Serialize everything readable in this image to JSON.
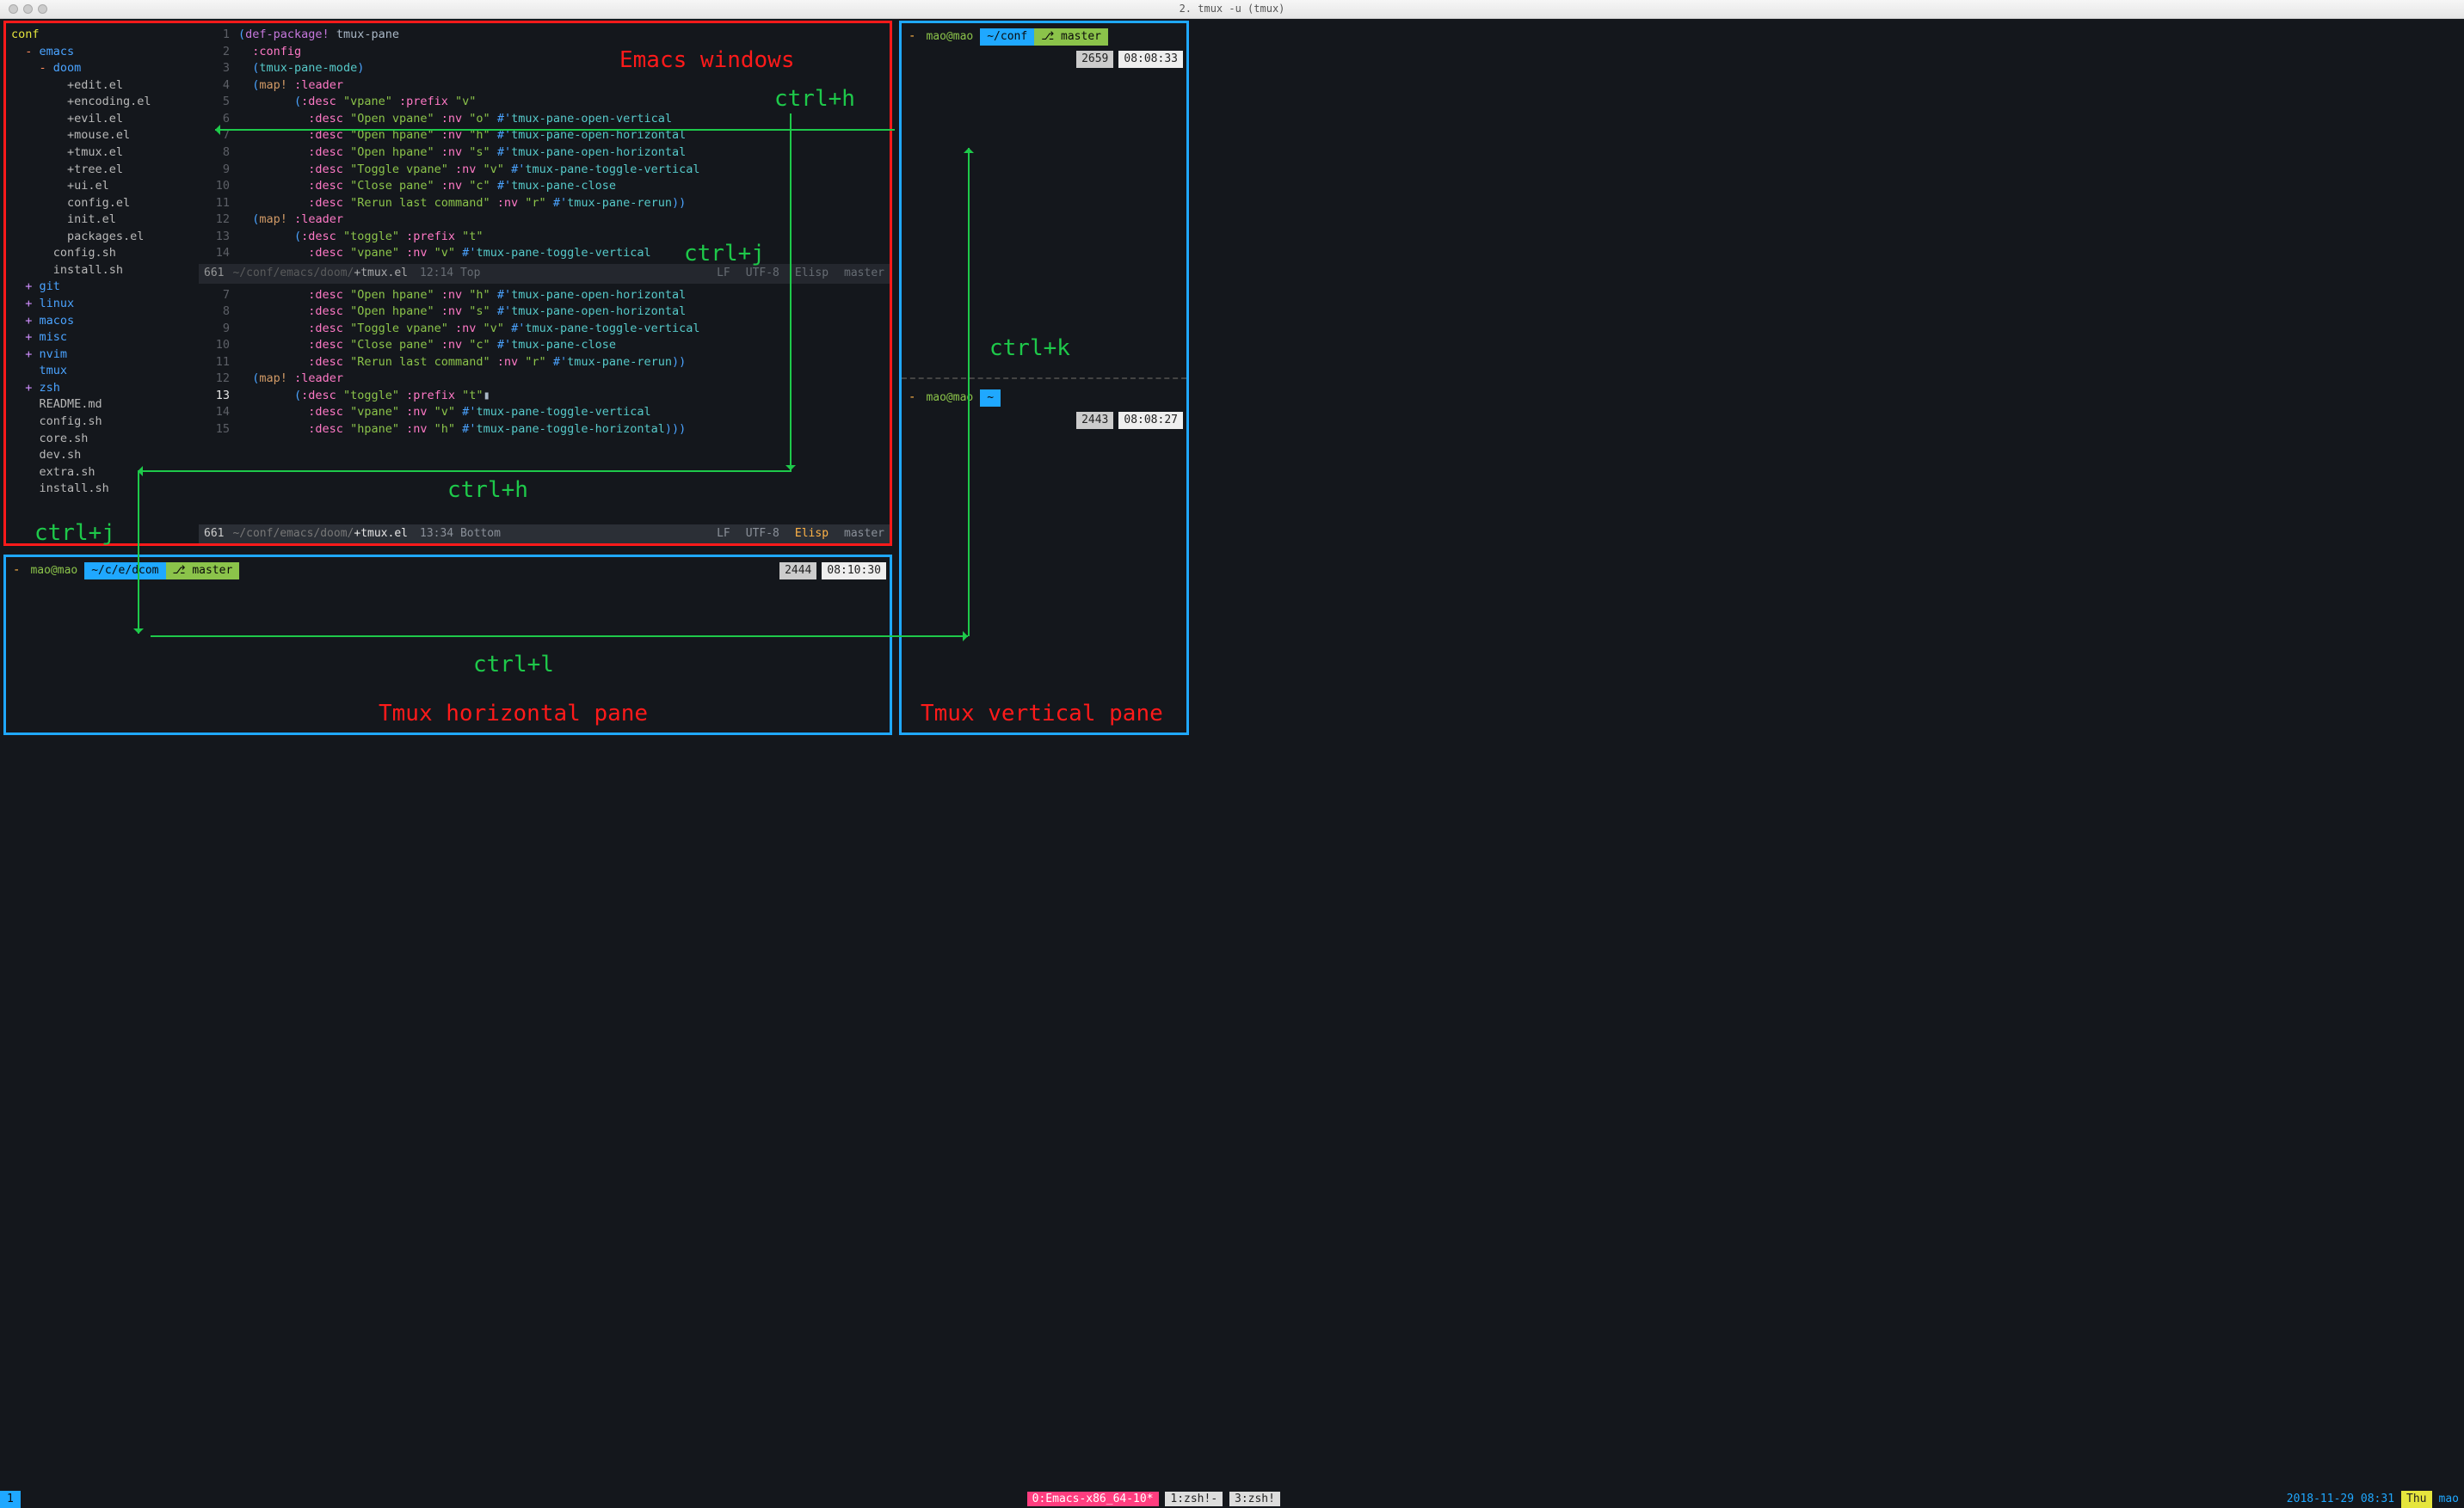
{
  "window": {
    "title": "2. tmux -u (tmux)"
  },
  "tree": {
    "root": "conf",
    "items": [
      {
        "depth": 0,
        "marker": "-",
        "label": "emacs",
        "type": "dir"
      },
      {
        "depth": 1,
        "marker": "-",
        "label": "doom",
        "type": "dir"
      },
      {
        "depth": 2,
        "marker": "",
        "label": "+edit.el",
        "type": "file"
      },
      {
        "depth": 2,
        "marker": "",
        "label": "+encoding.el",
        "type": "file"
      },
      {
        "depth": 2,
        "marker": "",
        "label": "+evil.el",
        "type": "file"
      },
      {
        "depth": 2,
        "marker": "",
        "label": "+mouse.el",
        "type": "file"
      },
      {
        "depth": 2,
        "marker": "",
        "label": "+tmux.el",
        "type": "file"
      },
      {
        "depth": 2,
        "marker": "",
        "label": "+tree.el",
        "type": "file"
      },
      {
        "depth": 2,
        "marker": "",
        "label": "+ui.el",
        "type": "file"
      },
      {
        "depth": 2,
        "marker": "",
        "label": "config.el",
        "type": "file"
      },
      {
        "depth": 2,
        "marker": "",
        "label": "init.el",
        "type": "file"
      },
      {
        "depth": 2,
        "marker": "",
        "label": "packages.el",
        "type": "file"
      },
      {
        "depth": 1,
        "marker": "",
        "label": "config.sh",
        "type": "file"
      },
      {
        "depth": 1,
        "marker": "",
        "label": "install.sh",
        "type": "file"
      },
      {
        "depth": 0,
        "marker": "+",
        "label": "git",
        "type": "dir"
      },
      {
        "depth": 0,
        "marker": "+",
        "label": "linux",
        "type": "dir"
      },
      {
        "depth": 0,
        "marker": "+",
        "label": "macos",
        "type": "dir"
      },
      {
        "depth": 0,
        "marker": "+",
        "label": "misc",
        "type": "dir"
      },
      {
        "depth": 0,
        "marker": "+",
        "label": "nvim",
        "type": "dir"
      },
      {
        "depth": 0,
        "marker": "",
        "label": "tmux",
        "type": "dir"
      },
      {
        "depth": 0,
        "marker": "+",
        "label": "zsh",
        "type": "dir"
      },
      {
        "depth": 0,
        "marker": "",
        "label": "README.md",
        "type": "file"
      },
      {
        "depth": 0,
        "marker": "",
        "label": "config.sh",
        "type": "file"
      },
      {
        "depth": 0,
        "marker": "",
        "label": "core.sh",
        "type": "file"
      },
      {
        "depth": 0,
        "marker": "",
        "label": "dev.sh",
        "type": "file"
      },
      {
        "depth": 0,
        "marker": "",
        "label": "extra.sh",
        "type": "file"
      },
      {
        "depth": 0,
        "marker": "",
        "label": "install.sh",
        "type": "file"
      }
    ]
  },
  "code_top": [
    {
      "n": "1",
      "tokens": [
        [
          "paren",
          "("
        ],
        [
          "kw",
          "def-package!"
        ],
        [
          "ident",
          " tmux-pane"
        ]
      ]
    },
    {
      "n": "2",
      "tokens": [
        [
          "ident",
          "  "
        ],
        [
          "kw2",
          ":config"
        ]
      ]
    },
    {
      "n": "3",
      "tokens": [
        [
          "ident",
          "  "
        ],
        [
          "paren",
          "("
        ],
        [
          "call",
          "tmux-pane-mode"
        ],
        [
          "paren",
          ")"
        ]
      ]
    },
    {
      "n": "4",
      "tokens": [
        [
          "ident",
          "  "
        ],
        [
          "paren",
          "("
        ],
        [
          "fn",
          "map!"
        ],
        [
          "ident",
          " "
        ],
        [
          "kw2",
          ":leader"
        ]
      ]
    },
    {
      "n": "5",
      "tokens": [
        [
          "ident",
          "        "
        ],
        [
          "paren",
          "("
        ],
        [
          "kw2",
          ":desc"
        ],
        [
          "ident",
          " "
        ],
        [
          "str",
          "\"vpane\""
        ],
        [
          "ident",
          " "
        ],
        [
          "kw2",
          ":prefix"
        ],
        [
          "ident",
          " "
        ],
        [
          "str",
          "\"v\""
        ]
      ]
    },
    {
      "n": "6",
      "tokens": [
        [
          "ident",
          "          "
        ],
        [
          "kw2",
          ":desc"
        ],
        [
          "ident",
          " "
        ],
        [
          "str",
          "\"Open vpane\""
        ],
        [
          "ident",
          " "
        ],
        [
          "kw2",
          ":nv"
        ],
        [
          "ident",
          " "
        ],
        [
          "str",
          "\"o\""
        ],
        [
          "ident",
          " "
        ],
        [
          "hash",
          "#"
        ],
        [
          "quote",
          "'"
        ],
        [
          "sym2",
          "tmux-pane-open-vertical"
        ]
      ]
    },
    {
      "n": "7",
      "tokens": [
        [
          "ident",
          "          "
        ],
        [
          "kw2",
          ":desc"
        ],
        [
          "ident",
          " "
        ],
        [
          "str",
          "\"Open hpane\""
        ],
        [
          "ident",
          " "
        ],
        [
          "kw2",
          ":nv"
        ],
        [
          "ident",
          " "
        ],
        [
          "str",
          "\"h\""
        ],
        [
          "ident",
          " "
        ],
        [
          "hash",
          "#"
        ],
        [
          "quote",
          "'"
        ],
        [
          "sym2",
          "tmux-pane-open-horizontal"
        ]
      ]
    },
    {
      "n": "8",
      "tokens": [
        [
          "ident",
          "          "
        ],
        [
          "kw2",
          ":desc"
        ],
        [
          "ident",
          " "
        ],
        [
          "str",
          "\"Open hpane\""
        ],
        [
          "ident",
          " "
        ],
        [
          "kw2",
          ":nv"
        ],
        [
          "ident",
          " "
        ],
        [
          "str",
          "\"s\""
        ],
        [
          "ident",
          " "
        ],
        [
          "hash",
          "#"
        ],
        [
          "quote",
          "'"
        ],
        [
          "sym2",
          "tmux-pane-open-horizontal"
        ]
      ]
    },
    {
      "n": "9",
      "tokens": [
        [
          "ident",
          "          "
        ],
        [
          "kw2",
          ":desc"
        ],
        [
          "ident",
          " "
        ],
        [
          "str",
          "\"Toggle vpane\""
        ],
        [
          "ident",
          " "
        ],
        [
          "kw2",
          ":nv"
        ],
        [
          "ident",
          " "
        ],
        [
          "str",
          "\"v\""
        ],
        [
          "ident",
          " "
        ],
        [
          "hash",
          "#"
        ],
        [
          "quote",
          "'"
        ],
        [
          "sym2",
          "tmux-pane-toggle-vertical"
        ]
      ]
    },
    {
      "n": "10",
      "tokens": [
        [
          "ident",
          "          "
        ],
        [
          "kw2",
          ":desc"
        ],
        [
          "ident",
          " "
        ],
        [
          "str",
          "\"Close pane\""
        ],
        [
          "ident",
          " "
        ],
        [
          "kw2",
          ":nv"
        ],
        [
          "ident",
          " "
        ],
        [
          "str",
          "\"c\""
        ],
        [
          "ident",
          " "
        ],
        [
          "hash",
          "#"
        ],
        [
          "quote",
          "'"
        ],
        [
          "sym2",
          "tmux-pane-close"
        ]
      ]
    },
    {
      "n": "11",
      "tokens": [
        [
          "ident",
          "          "
        ],
        [
          "kw2",
          ":desc"
        ],
        [
          "ident",
          " "
        ],
        [
          "str",
          "\"Rerun last command\""
        ],
        [
          "ident",
          " "
        ],
        [
          "kw2",
          ":nv"
        ],
        [
          "ident",
          " "
        ],
        [
          "str",
          "\"r\""
        ],
        [
          "ident",
          " "
        ],
        [
          "hash",
          "#"
        ],
        [
          "quote",
          "'"
        ],
        [
          "sym2",
          "tmux-pane-rerun"
        ],
        [
          "paren",
          "))"
        ]
      ]
    },
    {
      "n": "12",
      "tokens": [
        [
          "ident",
          "  "
        ],
        [
          "paren",
          "("
        ],
        [
          "fn",
          "map!"
        ],
        [
          "ident",
          " "
        ],
        [
          "kw2",
          ":leader"
        ]
      ]
    },
    {
      "n": "13",
      "tokens": [
        [
          "ident",
          "        "
        ],
        [
          "paren",
          "("
        ],
        [
          "kw2",
          ":desc"
        ],
        [
          "ident",
          " "
        ],
        [
          "str",
          "\"toggle\""
        ],
        [
          "ident",
          " "
        ],
        [
          "kw2",
          ":prefix"
        ],
        [
          "ident",
          " "
        ],
        [
          "str",
          "\"t\""
        ]
      ]
    },
    {
      "n": "14",
      "tokens": [
        [
          "ident",
          "          "
        ],
        [
          "kw2",
          ":desc"
        ],
        [
          "ident",
          " "
        ],
        [
          "str",
          "\"vpane\""
        ],
        [
          "ident",
          " "
        ],
        [
          "kw2",
          ":nv"
        ],
        [
          "ident",
          " "
        ],
        [
          "str",
          "\"v\""
        ],
        [
          "ident",
          " "
        ],
        [
          "hash",
          "#"
        ],
        [
          "quote",
          "'"
        ],
        [
          "sym2",
          "tmux-pane-toggle-vertical"
        ]
      ]
    }
  ],
  "modeline_top": {
    "num": "661",
    "path_dim": "~/conf/emacs/doom/",
    "path_bright": "+tmux.el",
    "pos": "12:14 Top",
    "lf": "LF",
    "enc": "UTF-8",
    "mode": "Elisp",
    "branch": "master"
  },
  "code_bot": [
    {
      "n": "7",
      "tokens": [
        [
          "ident",
          "          "
        ],
        [
          "kw2",
          ":desc"
        ],
        [
          "ident",
          " "
        ],
        [
          "str",
          "\"Open hpane\""
        ],
        [
          "ident",
          " "
        ],
        [
          "kw2",
          ":nv"
        ],
        [
          "ident",
          " "
        ],
        [
          "str",
          "\"h\""
        ],
        [
          "ident",
          " "
        ],
        [
          "hash",
          "#"
        ],
        [
          "quote",
          "'"
        ],
        [
          "sym2",
          "tmux-pane-open-horizontal"
        ]
      ]
    },
    {
      "n": "8",
      "tokens": [
        [
          "ident",
          "          "
        ],
        [
          "kw2",
          ":desc"
        ],
        [
          "ident",
          " "
        ],
        [
          "str",
          "\"Open hpane\""
        ],
        [
          "ident",
          " "
        ],
        [
          "kw2",
          ":nv"
        ],
        [
          "ident",
          " "
        ],
        [
          "str",
          "\"s\""
        ],
        [
          "ident",
          " "
        ],
        [
          "hash",
          "#"
        ],
        [
          "quote",
          "'"
        ],
        [
          "sym2",
          "tmux-pane-open-horizontal"
        ]
      ]
    },
    {
      "n": "9",
      "tokens": [
        [
          "ident",
          "          "
        ],
        [
          "kw2",
          ":desc"
        ],
        [
          "ident",
          " "
        ],
        [
          "str",
          "\"Toggle vpane\""
        ],
        [
          "ident",
          " "
        ],
        [
          "kw2",
          ":nv"
        ],
        [
          "ident",
          " "
        ],
        [
          "str",
          "\"v\""
        ],
        [
          "ident",
          " "
        ],
        [
          "hash",
          "#"
        ],
        [
          "quote",
          "'"
        ],
        [
          "sym2",
          "tmux-pane-toggle-vertical"
        ]
      ]
    },
    {
      "n": "10",
      "tokens": [
        [
          "ident",
          "          "
        ],
        [
          "kw2",
          ":desc"
        ],
        [
          "ident",
          " "
        ],
        [
          "str",
          "\"Close pane\""
        ],
        [
          "ident",
          " "
        ],
        [
          "kw2",
          ":nv"
        ],
        [
          "ident",
          " "
        ],
        [
          "str",
          "\"c\""
        ],
        [
          "ident",
          " "
        ],
        [
          "hash",
          "#"
        ],
        [
          "quote",
          "'"
        ],
        [
          "sym2",
          "tmux-pane-close"
        ]
      ]
    },
    {
      "n": "11",
      "tokens": [
        [
          "ident",
          "          "
        ],
        [
          "kw2",
          ":desc"
        ],
        [
          "ident",
          " "
        ],
        [
          "str",
          "\"Rerun last command\""
        ],
        [
          "ident",
          " "
        ],
        [
          "kw2",
          ":nv"
        ],
        [
          "ident",
          " "
        ],
        [
          "str",
          "\"r\""
        ],
        [
          "ident",
          " "
        ],
        [
          "hash",
          "#"
        ],
        [
          "quote",
          "'"
        ],
        [
          "sym2",
          "tmux-pane-rerun"
        ],
        [
          "paren",
          "))"
        ]
      ]
    },
    {
      "n": "12",
      "tokens": [
        [
          "ident",
          "  "
        ],
        [
          "paren",
          "("
        ],
        [
          "fn",
          "map!"
        ],
        [
          "ident",
          " "
        ],
        [
          "kw2",
          ":leader"
        ]
      ]
    },
    {
      "n": "13",
      "current": true,
      "tokens": [
        [
          "ident",
          "        "
        ],
        [
          "paren",
          "("
        ],
        [
          "kw2",
          ":desc"
        ],
        [
          "ident",
          " "
        ],
        [
          "str",
          "\"toggle\""
        ],
        [
          "ident",
          " "
        ],
        [
          "kw2",
          ":prefix"
        ],
        [
          "ident",
          " "
        ],
        [
          "str",
          "\"t\""
        ],
        [
          "ident",
          "▮"
        ]
      ]
    },
    {
      "n": "14",
      "tokens": [
        [
          "ident",
          "          "
        ],
        [
          "kw2",
          ":desc"
        ],
        [
          "ident",
          " "
        ],
        [
          "str",
          "\"vpane\""
        ],
        [
          "ident",
          " "
        ],
        [
          "kw2",
          ":nv"
        ],
        [
          "ident",
          " "
        ],
        [
          "str",
          "\"v\""
        ],
        [
          "ident",
          " "
        ],
        [
          "hash",
          "#"
        ],
        [
          "quote",
          "'"
        ],
        [
          "sym2",
          "tmux-pane-toggle-vertical"
        ]
      ]
    },
    {
      "n": "15",
      "tokens": [
        [
          "ident",
          "          "
        ],
        [
          "kw2",
          ":desc"
        ],
        [
          "ident",
          " "
        ],
        [
          "str",
          "\"hpane\""
        ],
        [
          "ident",
          " "
        ],
        [
          "kw2",
          ":nv"
        ],
        [
          "ident",
          " "
        ],
        [
          "str",
          "\"h\""
        ],
        [
          "ident",
          " "
        ],
        [
          "hash",
          "#"
        ],
        [
          "quote",
          "'"
        ],
        [
          "sym2",
          "tmux-pane-toggle-horizontal"
        ],
        [
          "paren",
          ")))"
        ]
      ]
    }
  ],
  "modeline_bot": {
    "num": "661",
    "path_dim": "~/conf/emacs/doom/",
    "path_bright": "+tmux.el",
    "pos": "13:34 Bottom",
    "lf": "LF",
    "enc": "UTF-8",
    "mode": "Elisp",
    "branch": "master"
  },
  "bottom_pane": {
    "user": "mao@mao",
    "path": "~/c/e/dcom",
    "branch_icon": "⎇",
    "branch": "master",
    "hist": "2444",
    "time": "08:10:30"
  },
  "right_pane_top": {
    "user": "mao@mao",
    "path": "~/conf",
    "branch_icon": "⎇",
    "branch": "master",
    "hist": "2659",
    "time": "08:08:33"
  },
  "right_pane_bot": {
    "user": "mao@mao",
    "path": "~",
    "hist": "2443",
    "time": "08:08:27"
  },
  "statusbar": {
    "session": "1",
    "windows": [
      {
        "label": "0:Emacs-x86_64-10*",
        "active": true
      },
      {
        "label": "1:zsh!-",
        "active": false
      },
      {
        "label": "3:zsh!",
        "active": false
      }
    ],
    "date": "2018-11-29 08:31",
    "day": "Thu",
    "user": "mao"
  },
  "annotations": {
    "emacs_windows": "Emacs windows",
    "tmux_h": "Tmux horizontal pane",
    "tmux_v": "Tmux vertical pane",
    "ctrl_h": "ctrl+h",
    "ctrl_j": "ctrl+j",
    "ctrl_k": "ctrl+k",
    "ctrl_l": "ctrl+l"
  }
}
